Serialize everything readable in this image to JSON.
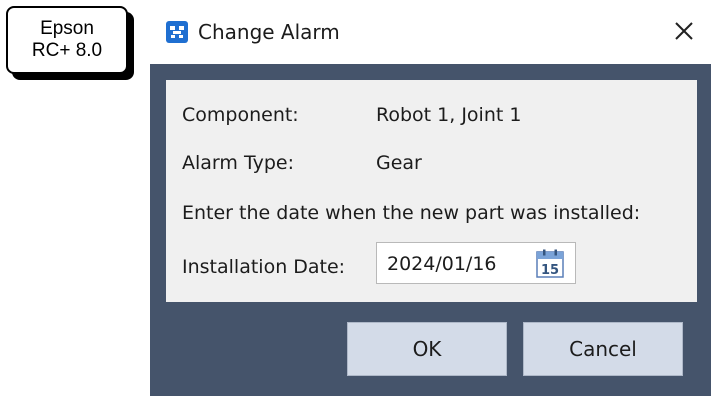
{
  "badge": {
    "line1": "Epson",
    "line2": "RC+ 8.0"
  },
  "dialog": {
    "title": "Change Alarm",
    "component_label": "Component:",
    "component_value": "Robot 1, Joint 1",
    "alarm_type_label": "Alarm Type:",
    "alarm_type_value": "Gear",
    "prompt": "Enter the date when the new part was installed:",
    "install_date_label": "Installation Date:",
    "install_date_value": "2024/01/16",
    "calendar_day": "15",
    "ok_label": "OK",
    "cancel_label": "Cancel"
  },
  "colors": {
    "frame": "#45546b",
    "panel": "#f0f0f0",
    "button": "#d3dbe8",
    "title_icon": "#1f6fd1"
  },
  "icons": {
    "title": "app-icon",
    "close": "close-icon",
    "calendar": "calendar-icon"
  }
}
